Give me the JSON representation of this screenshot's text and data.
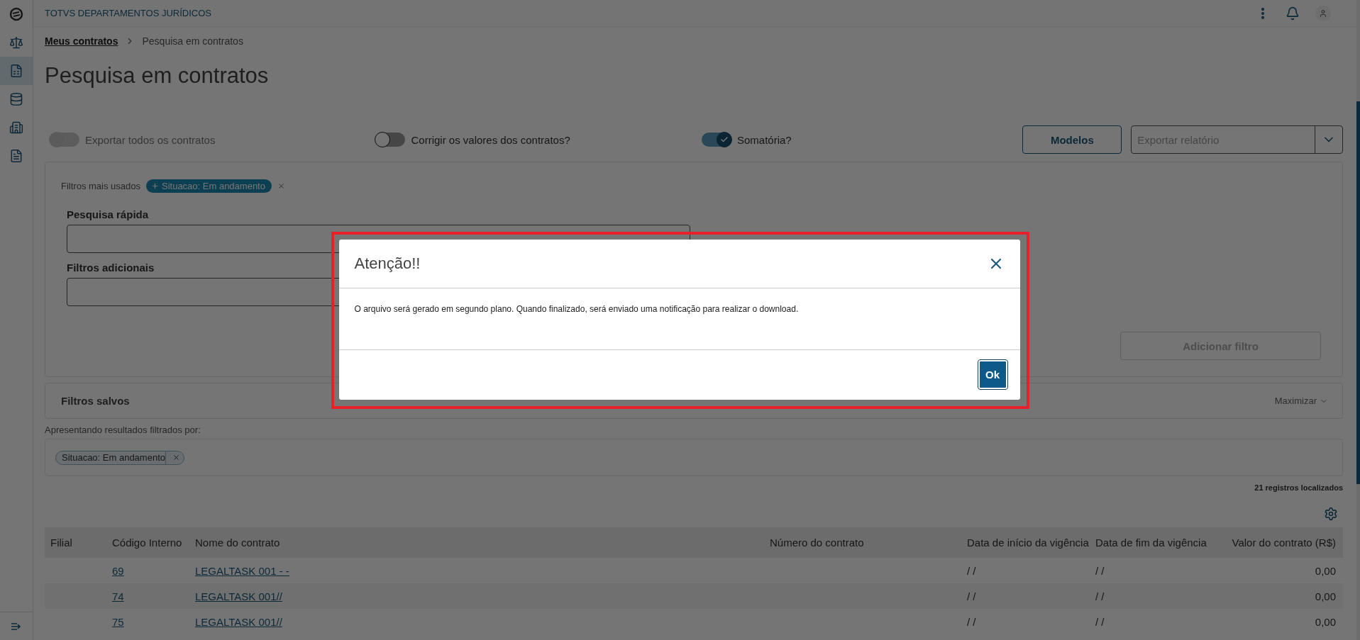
{
  "sidebar": {
    "items": [
      {
        "selected": false
      },
      {
        "selected": true
      },
      {
        "selected": false
      },
      {
        "selected": false
      },
      {
        "selected": false
      }
    ]
  },
  "header": {
    "app_title": "TOTVS DEPARTAMENTOS JURÍDICOS"
  },
  "breadcrumb": [
    {
      "label": "Meus contratos",
      "current": false
    },
    {
      "label": "Pesquisa em contratos",
      "current": true
    }
  ],
  "title": "Pesquisa em contratos",
  "toggles": [
    {
      "label": "Exportar todos os contratos",
      "on": false,
      "disabled": true
    },
    {
      "label": "Corrigir os valores dos contratos?",
      "on": false,
      "disabled": false
    },
    {
      "label": "Somatória?",
      "on": true,
      "disabled": false
    }
  ],
  "models_button": "Modelos",
  "export_select": {
    "placeholder": "Exportar relatório"
  },
  "filters": {
    "most_used_label": "Filtros mais usados",
    "most_used_chips": [
      {
        "label": "Situacao: Em andamento"
      }
    ],
    "quick_search_label": "Pesquisa rápida",
    "additional_filters_label": "Filtros adicionais",
    "add_button": {
      "label": "Adicionar filtro",
      "disabled": true
    }
  },
  "saved_filters": {
    "title": "Filtros salvos",
    "action": "Maximizar"
  },
  "results": {
    "label": "Apresentando resultados filtrados por:",
    "chips": [
      {
        "label": "Situacao: Em andamento"
      }
    ],
    "count": "21 registros localizados"
  },
  "table": {
    "columns": [
      "Filial",
      "Código Interno",
      "Nome do contrato",
      "Número do contrato",
      "Data de início da vigência",
      "Data de fim da vigência",
      "Valor do contrato (R$)"
    ],
    "rows": [
      [
        "",
        "69",
        "LEGALTASK 001 - -",
        "",
        "/ /",
        "/ /",
        "0,00"
      ],
      [
        "",
        "74",
        "LEGALTASK 001//",
        "",
        "/ /",
        "/ /",
        "0,00"
      ],
      [
        "",
        "75",
        "LEGALTASK 001//",
        "",
        "/ /",
        "/ /",
        "0,00"
      ]
    ]
  },
  "dialog": {
    "title": "Atenção!!",
    "message": "O arquivo será gerado em segundo plano. Quando finalizado, será enviado uma notificação para realizar o download.",
    "ok_button": "Ok"
  }
}
